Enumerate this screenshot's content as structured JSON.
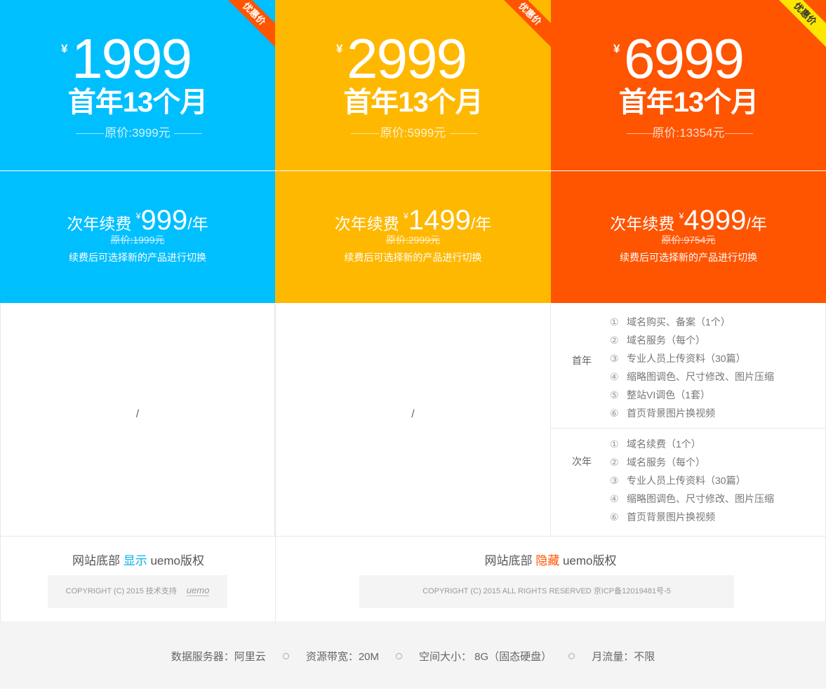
{
  "plans": [
    {
      "badge": "优惠价",
      "currency": "¥",
      "price": "1999",
      "period": "首年13个月",
      "original": "原价:3999元",
      "renew_label": "次年续费",
      "renew_currency": "¥",
      "renew_price": "999",
      "renew_unit": "/年",
      "renew_original": "原价:1999元",
      "renew_note": "续费后可选择新的产品进行切换",
      "services_placeholder": "/",
      "colors": {
        "bg": "#00bfff",
        "badge_bg": "#ff5400"
      }
    },
    {
      "badge": "优惠价",
      "currency": "¥",
      "price": "2999",
      "period": "首年13个月",
      "original": "原价:5999元",
      "renew_label": "次年续费",
      "renew_currency": "¥",
      "renew_price": "1499",
      "renew_unit": "/年",
      "renew_original": "原价:2999元",
      "renew_note": "续费后可选择新的产品进行切换",
      "services_placeholder": "/",
      "colors": {
        "bg": "#ffb800",
        "badge_bg": "#ff5400"
      }
    },
    {
      "badge": "优惠价",
      "currency": "¥",
      "price": "6999",
      "period": "首年13个月",
      "original": "原价:13354元",
      "renew_label": "次年续费",
      "renew_currency": "¥",
      "renew_price": "4999",
      "renew_unit": "/年",
      "renew_original": "原价:9754元",
      "renew_note": "续费后可选择新的产品进行切换",
      "colors": {
        "bg": "#ff5400",
        "badge_bg": "#ffe600"
      },
      "services": {
        "first_year": {
          "label": "首年",
          "items": [
            {
              "num": "①",
              "text": "域名购买、备案（1个）"
            },
            {
              "num": "②",
              "text": "域名服务（每个）"
            },
            {
              "num": "③",
              "text": "专业人员上传资料（30篇）"
            },
            {
              "num": "④",
              "text": "缩略图调色、尺寸修改、图片压缩"
            },
            {
              "num": "⑤",
              "text": "整站VI调色（1套）"
            },
            {
              "num": "⑥",
              "text": "首页背景图片换视频"
            }
          ]
        },
        "second_year": {
          "label": "次年",
          "items": [
            {
              "num": "①",
              "text": "域名续费（1个）"
            },
            {
              "num": "②",
              "text": "域名服务（每个）"
            },
            {
              "num": "③",
              "text": "专业人员上传资料（30篇）"
            },
            {
              "num": "④",
              "text": "缩略图调色、尺寸修改、图片压缩"
            },
            {
              "num": "⑥",
              "text": "首页背景图片换视频"
            }
          ]
        }
      }
    }
  ],
  "copyright": {
    "left": {
      "prefix": "网站底部",
      "highlight": "显示",
      "suffix": "uemo版权",
      "box_text": "COPYRIGHT (C) 2015    技术支持",
      "logo": "uemo"
    },
    "right": {
      "prefix": "网站底部",
      "highlight": "隐藏",
      "suffix": "uemo版权",
      "box_text": "COPYRIGHT (C) 2015  ALL RIGHTS RESERVED 京ICP备12019481号-5"
    }
  },
  "footer": {
    "items": [
      "数据服务器：阿里云",
      "资源带宽：20M",
      "空间大小：  8G（固态硬盘）",
      "月流量：不限"
    ]
  }
}
